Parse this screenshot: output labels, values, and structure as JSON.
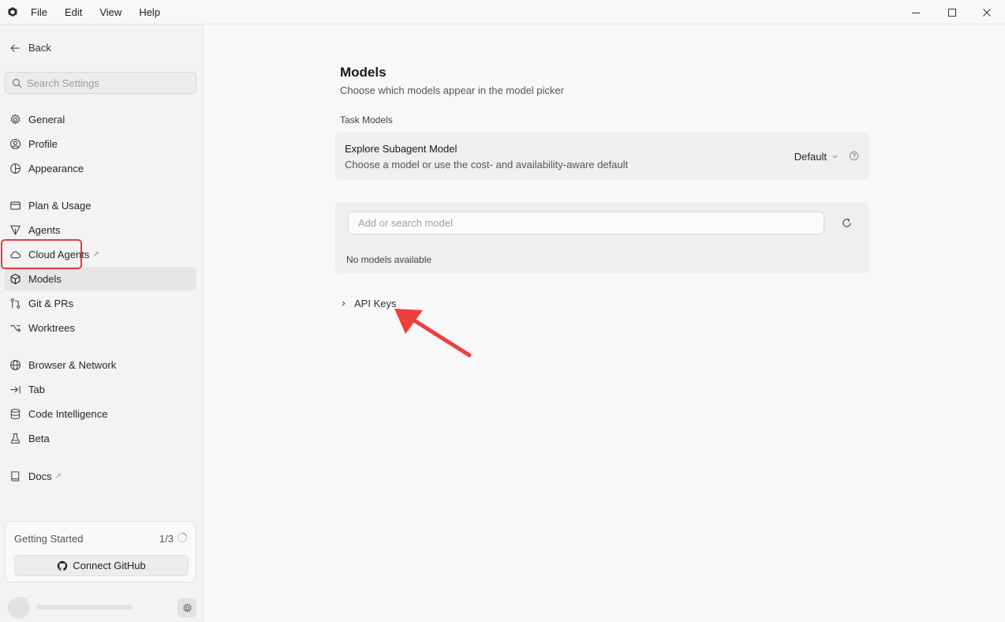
{
  "menu": {
    "file": "File",
    "edit": "Edit",
    "view": "View",
    "help": "Help"
  },
  "sidebar": {
    "back": "Back",
    "search_placeholder": "Search Settings",
    "items": {
      "general": "General",
      "profile": "Profile",
      "appearance": "Appearance",
      "plan_usage": "Plan & Usage",
      "agents": "Agents",
      "cloud_agents": "Cloud Agents",
      "models": "Models",
      "git_prs": "Git & PRs",
      "worktrees": "Worktrees",
      "browser_network": "Browser & Network",
      "tab": "Tab",
      "code_intelligence": "Code Intelligence",
      "beta": "Beta",
      "docs": "Docs"
    },
    "external_glyph": "↗",
    "active_item": "Models",
    "getting_started": {
      "title": "Getting Started",
      "progress": "1/3",
      "button": "Connect GitHub"
    }
  },
  "main": {
    "title": "Models",
    "subtitle": "Choose which models appear in the model picker",
    "task_models": {
      "label": "Task Models",
      "name": "Explore Subagent Model",
      "description": "Choose a model or use the cost- and availability-aware default",
      "selected": "Default"
    },
    "models": {
      "search_placeholder": "Add or search model",
      "empty": "No models available"
    },
    "api_keys": "API Keys"
  },
  "colors": {
    "highlight": "#e5393f",
    "arrow": "#ef3e3e",
    "sidebar_bg": "#f3f3f3",
    "main_bg": "#f8f8f8"
  },
  "icons": [
    "app-logo-icon",
    "minimize-icon",
    "maximize-icon",
    "close-icon",
    "arrow-left-icon",
    "search-icon",
    "gear-icon",
    "user-circle-icon",
    "palette-icon",
    "card-icon",
    "agents-icon",
    "cloud-icon",
    "cube-icon",
    "git-icon",
    "worktree-icon",
    "globe-icon",
    "tab-arrow-icon",
    "database-icon",
    "flask-icon",
    "book-icon",
    "github-icon",
    "chevron-down-icon",
    "help-icon",
    "refresh-icon",
    "chevron-right-icon"
  ]
}
